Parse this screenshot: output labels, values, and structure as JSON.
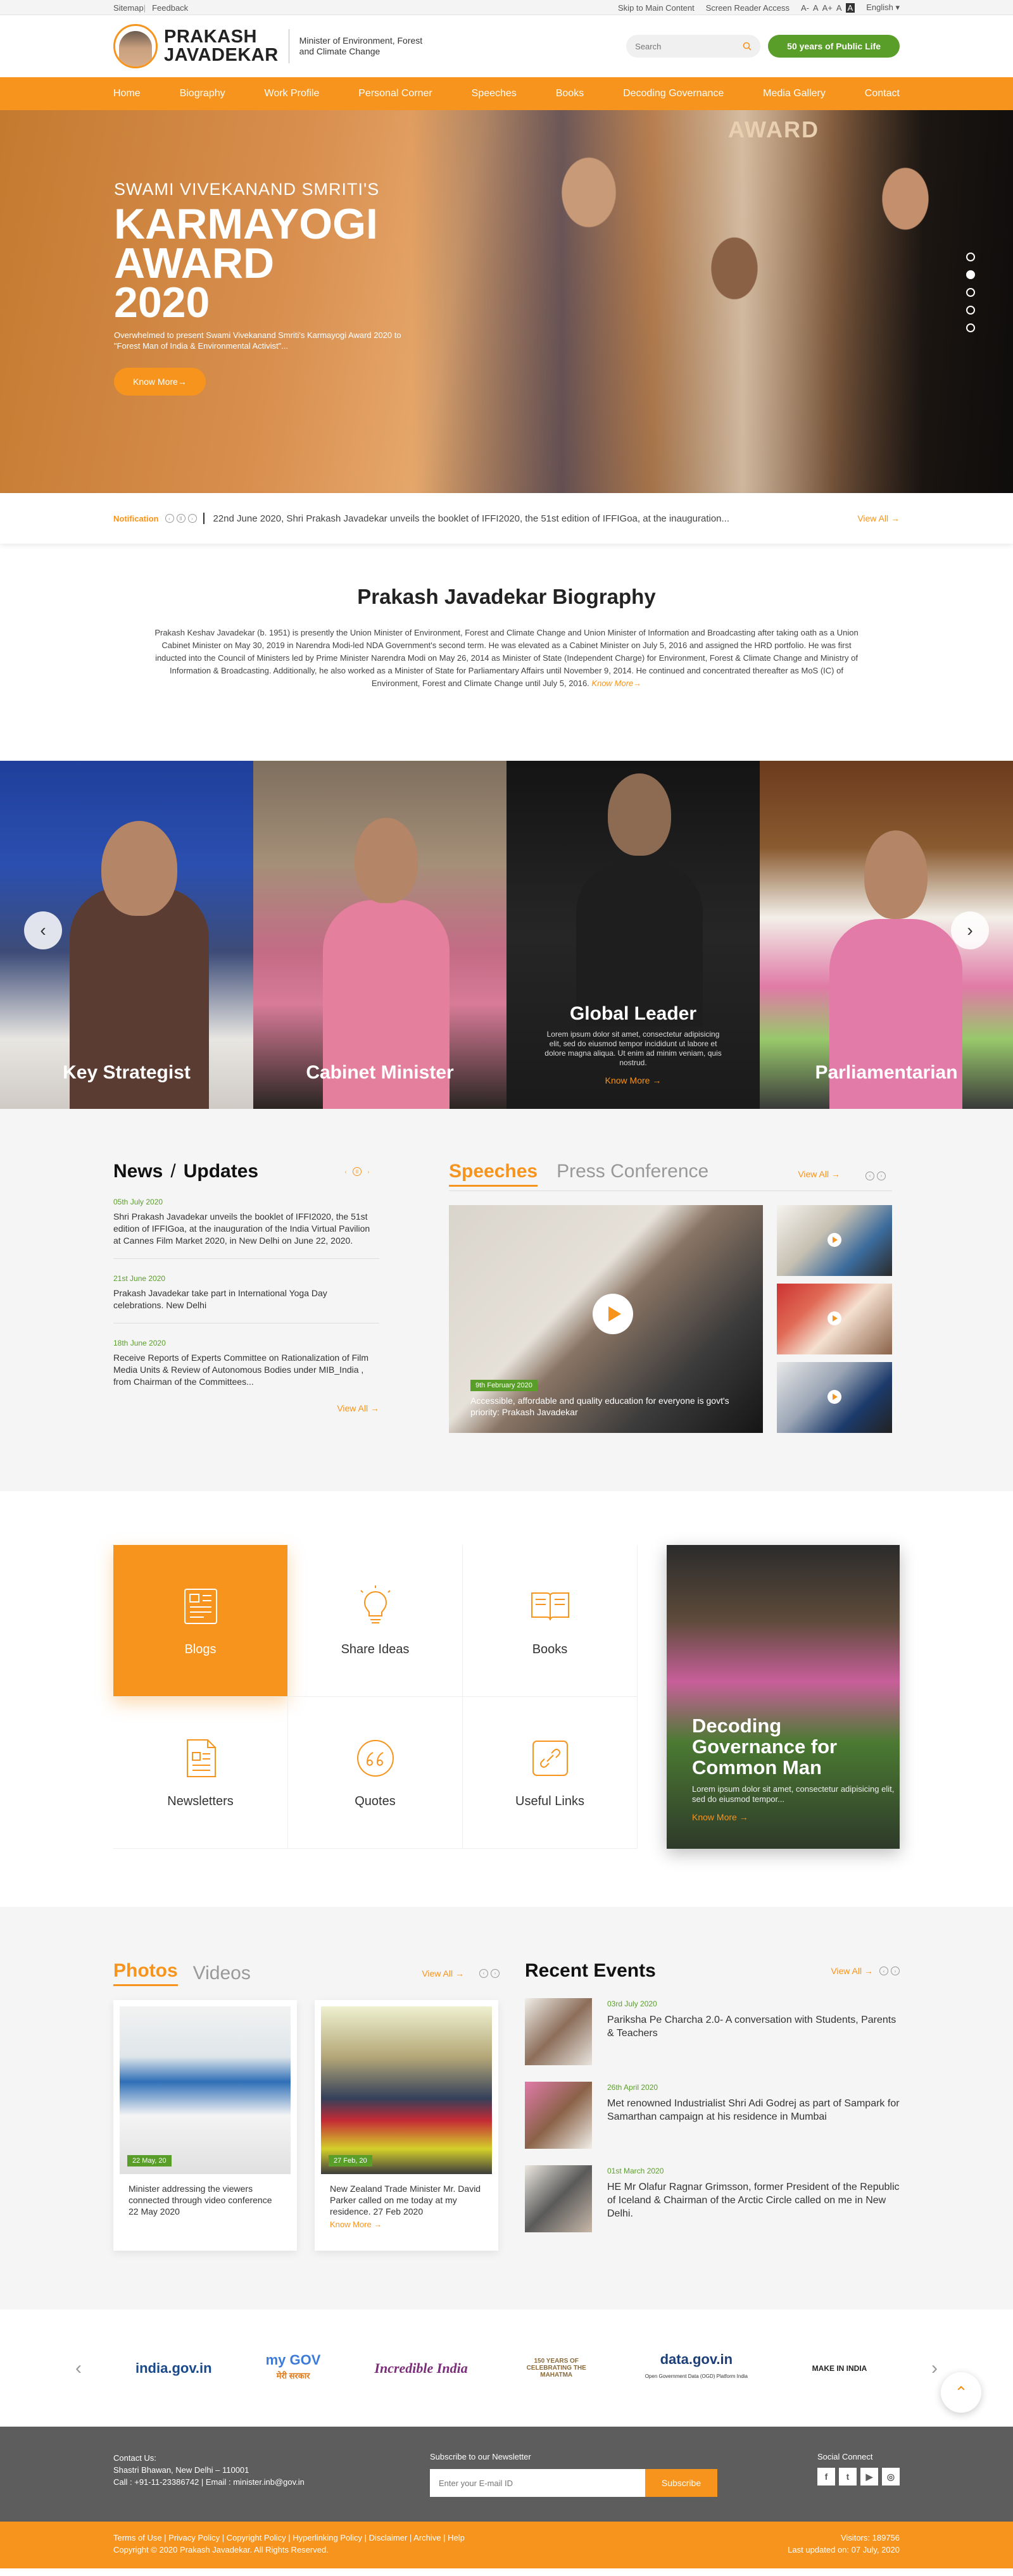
{
  "util": {
    "sitemap": "Sitemap",
    "feedback": "Feedback",
    "skip": "Skip to Main Content",
    "reader": "Screen Reader Access",
    "font": [
      "A-",
      "A",
      "A+"
    ],
    "contrast": "A",
    "lang": "English ▾"
  },
  "header": {
    "name1": "PRAKASH",
    "name2": "JAVADEKAR",
    "subtitle": "Minister of Environment, Forest and Climate Change",
    "search_placeholder": "Search",
    "cta": "50 years of Public Life"
  },
  "nav": [
    "Home",
    "Biography",
    "Work Profile",
    "Personal Corner",
    "Speeches",
    "Books",
    "Decoding Governance",
    "Media Gallery",
    "Contact"
  ],
  "hero": {
    "kicker": "SWAMI VIVEKANAND SMRITI'S",
    "title1": "KARMAYOGI",
    "title2": "AWARD",
    "title3": "2020",
    "desc": "Overwhelmed to present Swami Vivekanand Smriti's Karmayogi Award 2020 to \"Forest Man of India & Environmental Activist\"...",
    "button": "Know More→",
    "badge": "AWARD"
  },
  "notification": {
    "label": "Notification",
    "text": "22nd June 2020,  Shri Prakash Javadekar unveils the booklet of IFFI2020, the 51st edition of IFFIGoa, at the inauguration...",
    "view_all": "View All →"
  },
  "bio": {
    "title": "Prakash Javadekar Biography",
    "text": "Prakash Keshav Javadekar (b. 1951) is presently the Union Minister of Environment, Forest and Climate Change and Union Minister of Information and Broadcasting after taking oath as a Union Cabinet Minister on May 30, 2019 in Narendra Modi-led NDA Government's second term.  He was elevated as a Cabinet Minister on July 5, 2016 and assigned the HRD portfolio. He was first inducted into the Council of Ministers led by Prime Minister Narendra Modi on May 26, 2014 as Minister of State (Independent Charge) for Environment, Forest & Climate Change and Ministry of Information & Broadcasting. Additionally, he also worked as a Minister of State for Parliamentary Affairs until November 9, 2014. He continued and concentrated thereafter as MoS (IC) of Environment, Forest and Climate Change until July 5, 2016.",
    "know_more": "Know More→"
  },
  "strip": {
    "p1": "Key Strategist",
    "p2": "Cabinet Minister",
    "p3": "Global Leader",
    "p3_desc": "Lorem ipsum dolor sit amet, consectetur adipisicing elit, sed do eiusmod tempor incididunt ut labore et dolore magna aliqua. Ut enim ad minim veniam, quis nostrud.",
    "p3_link": "Know More →",
    "p4": "Parliamentarian"
  },
  "news": {
    "title1": "News",
    "title2": "Updates",
    "items": [
      {
        "date": "05th July 2020",
        "text": "Shri Prakash Javadekar unveils the booklet of IFFI2020, the 51st edition of IFFIGoa, at the inauguration of the India Virtual Pavilion at Cannes Film Market 2020, in New Delhi on June 22, 2020."
      },
      {
        "date": "21st June 2020",
        "text": "Prakash Javadekar take part in International Yoga Day celebrations. New Delhi"
      },
      {
        "date": "18th June 2020",
        "text": "Receive Reports of Experts Committee on Rationalization of Film Media Units & Review of Autonomous Bodies under MIB_India , from Chairman of the Committees..."
      }
    ],
    "view_all": "View All →"
  },
  "speeches": {
    "tab1": "Speeches",
    "tab2": "Press Conference",
    "view_all": "View All →",
    "date": "9th February 2020",
    "caption": "Accessible, affordable and quality education for everyone is govt's priority: Prakash Javadekar"
  },
  "tiles": [
    "Blogs",
    "Share Ideas",
    "Books",
    "Newsletters",
    "Quotes",
    "Useful Links"
  ],
  "decoding": {
    "title": "Decoding Governance for Common Man",
    "desc": "Lorem ipsum dolor sit amet, consectetur adipisicing elit, sed do eiusmod tempor...",
    "link": "Know More →"
  },
  "photos": {
    "tab1": "Photos",
    "tab2": "Videos",
    "view_all": "View All →",
    "cards": [
      {
        "date": "22 May, 20",
        "text": "Minister addressing the viewers connected through video conference 22 May 2020"
      },
      {
        "date": "27 Feb, 20",
        "text": "New Zealand Trade Minister Mr. David Parker called on me today at my residence. 27 Feb 2020",
        "link": "Know More →"
      }
    ]
  },
  "events": {
    "title": "Recent Events",
    "view_all": "View All →",
    "items": [
      {
        "date": "03rd July 2020",
        "text": "Pariksha Pe Charcha 2.0- A conversation with Students, Parents & Teachers"
      },
      {
        "date": "26th April 2020",
        "text": "Met renowned Industrialist Shri Adi Godrej as part of Sampark for Samarthan campaign at his residence in Mumbai"
      },
      {
        "date": "01st March 2020",
        "text": "HE Mr Olafur Ragnar Grimsson, former President of the Republic of Iceland & Chairman of the Arctic Circle called on me in New Delhi."
      }
    ]
  },
  "partners": [
    "india.gov.in",
    "my GOV",
    "Incredible India",
    "150 YEARS OF CELEBRATING THE MAHATMA",
    "data.gov.in",
    "MAKE IN INDIA"
  ],
  "partner_sub": {
    "mygov": "मेरी सरकार",
    "datagov": "Open Government Data (OGD) Platform India"
  },
  "footer": {
    "contact_label": "Contact Us:",
    "address": "Shastri Bhawan, New Delhi – 110001",
    "phone": "Call : +91-11-23386742",
    "email": "Email : minister.inb@gov.in",
    "newsletter_label": "Subscribe to our Newsletter",
    "email_placeholder": "Enter your E-mail ID",
    "subscribe": "Subscribe",
    "social": "Social Connect",
    "links": "Terms of Use  |  Privacy Policy  |  Copyright Policy  |  Hyperlinking Policy  |  Disclaimer  |  Archive  |  Help",
    "copyright": "Copyright © 2020 Prakash Javadekar. All Rights Reserved.",
    "visitors": "Visitors: 189756",
    "updated": "Last updated on: 07 July, 2020"
  },
  "colors": {
    "accent": "#f7941d",
    "green": "#5a9e2a",
    "footer": "#5d5d5d"
  }
}
